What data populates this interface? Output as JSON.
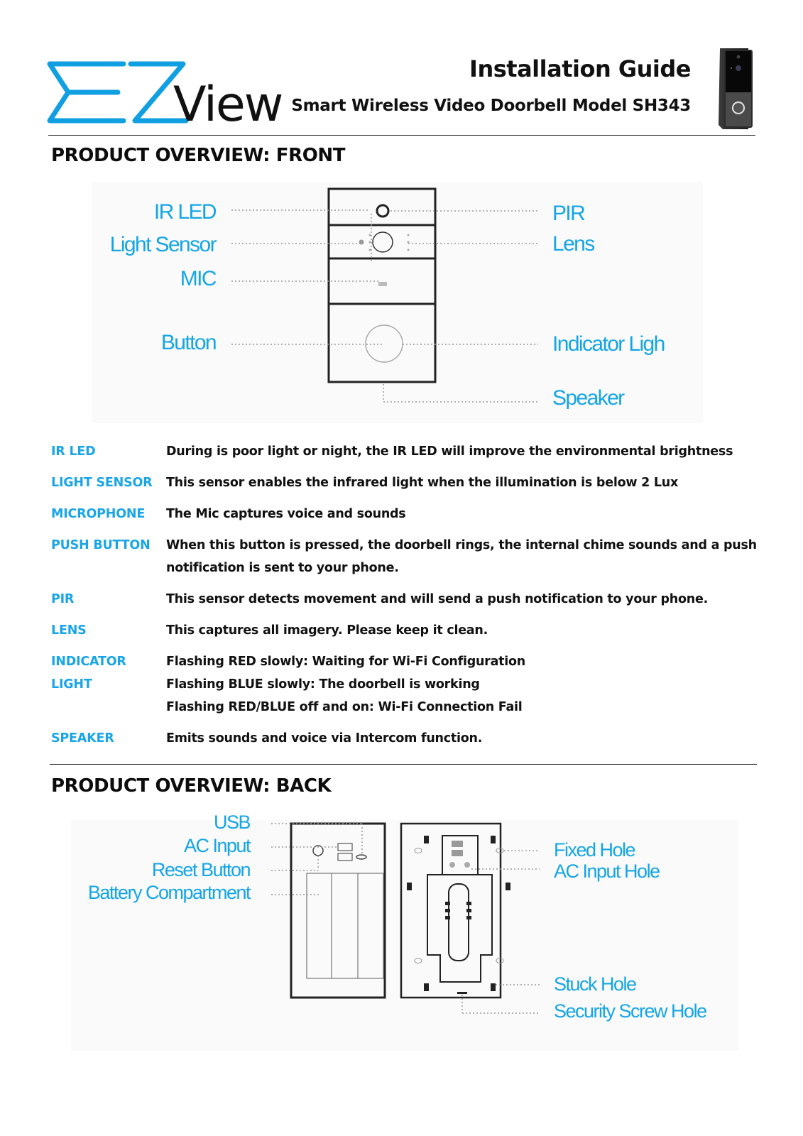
{
  "header": {
    "brand_logo": "EZView",
    "brand_suffix": "View",
    "title": "Installation Guide",
    "subtitle": "Smart Wireless Video Doorbell Model SH343",
    "product_photo": "doorbell-photo"
  },
  "sections": {
    "front_title": "PRODUCT OVERVIEW: FRONT",
    "back_title": "PRODUCT OVERVIEW: BACK"
  },
  "front_diagram": {
    "left_labels": [
      "IR LED",
      "Light Sensor",
      "MIC",
      "Button"
    ],
    "right_labels": [
      "PIR",
      "Lens",
      "Indicator Ligh",
      "Speaker"
    ]
  },
  "definitions": [
    {
      "term": [
        "IR LED"
      ],
      "desc": [
        "During is poor light or night, the IR LED will improve the environmental brightness"
      ]
    },
    {
      "term": [
        "LIGHT SENSOR"
      ],
      "desc": [
        "This sensor enables the infrared light when the illumination is below 2 Lux"
      ]
    },
    {
      "term": [
        "MICROPHONE"
      ],
      "desc": [
        "The Mic captures voice and sounds"
      ]
    },
    {
      "term": [
        "PUSH BUTTON"
      ],
      "desc": [
        "When this button is pressed, the doorbell rings, the internal chime sounds and a push",
        "notification is sent to your phone."
      ]
    },
    {
      "term": [
        "PIR"
      ],
      "desc": [
        "This sensor detects movement and will send a push notification to your phone."
      ]
    },
    {
      "term": [
        "LENS"
      ],
      "desc": [
        "This captures all imagery. Please keep it clean."
      ]
    },
    {
      "term": [
        "INDICATOR",
        "LIGHT"
      ],
      "desc": [
        "Flashing RED slowly: Waiting for Wi-Fi Configuration",
        "Flashing BLUE slowly: The doorbell is working",
        "Flashing RED/BLUE off and on: Wi-Fi Connection Fail"
      ]
    },
    {
      "term": [
        "SPEAKER"
      ],
      "desc": [
        "Emits sounds and voice via Intercom function."
      ]
    }
  ],
  "back_diagram": {
    "left_labels": [
      "USB",
      "AC Input",
      "Reset Button",
      "Battery Compartment"
    ],
    "right_labels": [
      "Fixed Hole",
      "AC Input Hole",
      "Stuck Hole",
      "Security Screw Hole"
    ]
  },
  "colors": {
    "accent_blue": "#14a5e6",
    "text": "#111111"
  }
}
